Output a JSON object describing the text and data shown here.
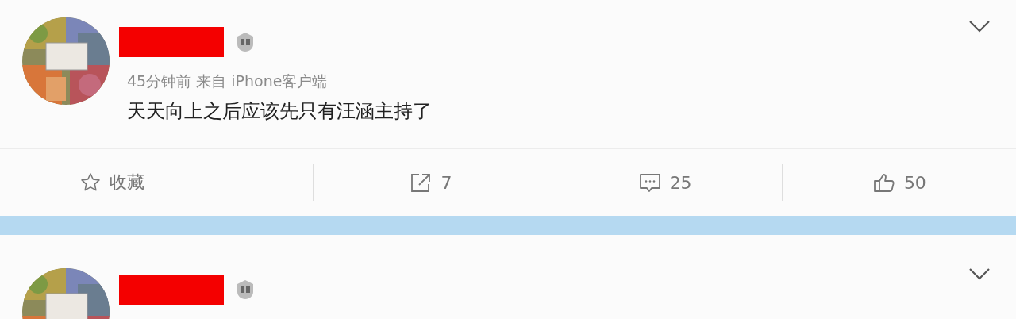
{
  "posts": [
    {
      "kind": "full",
      "meta": "45分钟前 来自 iPhone客户端",
      "text": "天天向上之后应该先只有汪涵主持了",
      "actions": [
        {
          "kind": "favorite",
          "label": "收藏"
        },
        {
          "kind": "repost",
          "label": "7"
        },
        {
          "kind": "comment",
          "label": "25"
        },
        {
          "kind": "like",
          "label": "50"
        }
      ]
    },
    {
      "kind": "cut"
    }
  ]
}
